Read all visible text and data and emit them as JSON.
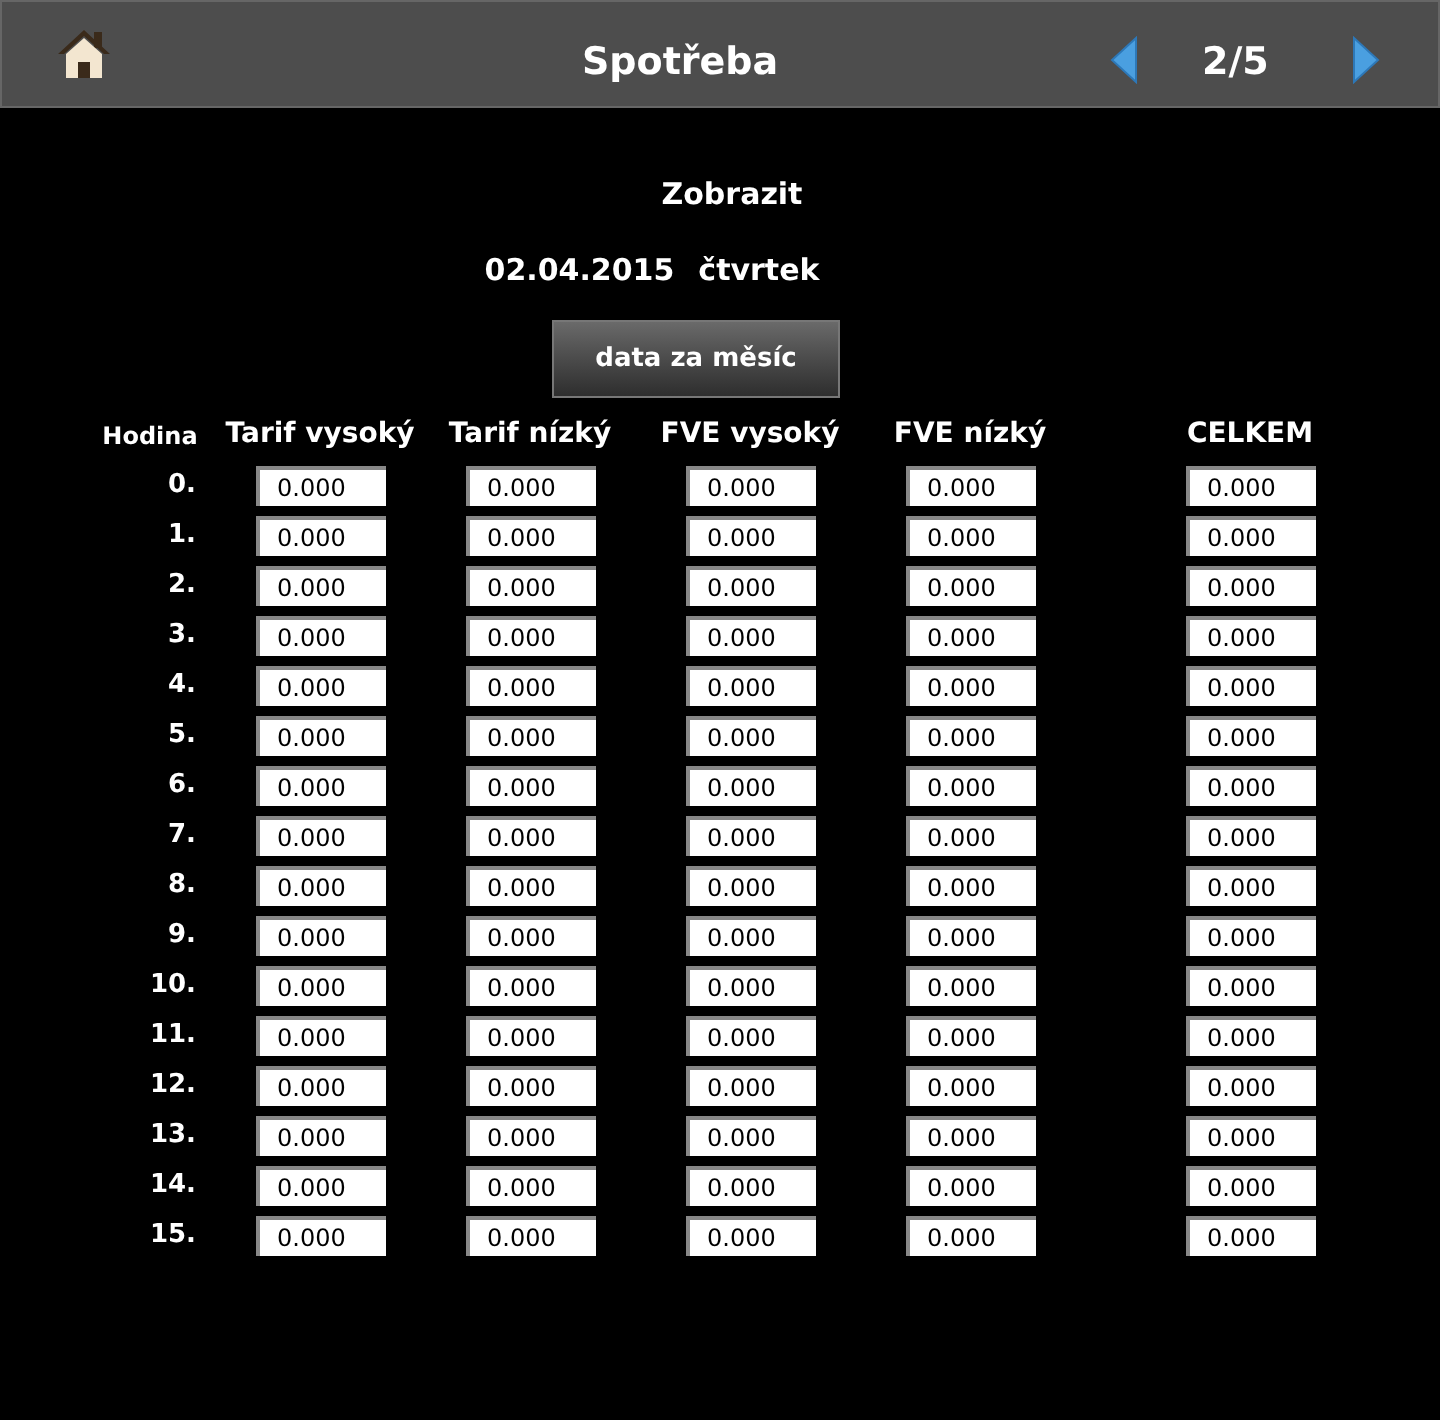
{
  "header": {
    "title": "Spotřeba",
    "page": "2/5"
  },
  "section_title": "Zobrazit",
  "date": "02.04.2015",
  "weekday": "čtvrtek",
  "month_button": "data za měsíc",
  "table": {
    "columns": [
      "Hodina",
      "Tarif vysoký",
      "Tarif nízký",
      "FVE vysoký",
      "FVE nízký",
      "CELKEM"
    ],
    "rows": [
      {
        "hour": "0.",
        "values": [
          "0.000",
          "0.000",
          "0.000",
          "0.000",
          "0.000"
        ]
      },
      {
        "hour": "1.",
        "values": [
          "0.000",
          "0.000",
          "0.000",
          "0.000",
          "0.000"
        ]
      },
      {
        "hour": "2.",
        "values": [
          "0.000",
          "0.000",
          "0.000",
          "0.000",
          "0.000"
        ]
      },
      {
        "hour": "3.",
        "values": [
          "0.000",
          "0.000",
          "0.000",
          "0.000",
          "0.000"
        ]
      },
      {
        "hour": "4.",
        "values": [
          "0.000",
          "0.000",
          "0.000",
          "0.000",
          "0.000"
        ]
      },
      {
        "hour": "5.",
        "values": [
          "0.000",
          "0.000",
          "0.000",
          "0.000",
          "0.000"
        ]
      },
      {
        "hour": "6.",
        "values": [
          "0.000",
          "0.000",
          "0.000",
          "0.000",
          "0.000"
        ]
      },
      {
        "hour": "7.",
        "values": [
          "0.000",
          "0.000",
          "0.000",
          "0.000",
          "0.000"
        ]
      },
      {
        "hour": "8.",
        "values": [
          "0.000",
          "0.000",
          "0.000",
          "0.000",
          "0.000"
        ]
      },
      {
        "hour": "9.",
        "values": [
          "0.000",
          "0.000",
          "0.000",
          "0.000",
          "0.000"
        ]
      },
      {
        "hour": "10.",
        "values": [
          "0.000",
          "0.000",
          "0.000",
          "0.000",
          "0.000"
        ]
      },
      {
        "hour": "11.",
        "values": [
          "0.000",
          "0.000",
          "0.000",
          "0.000",
          "0.000"
        ]
      },
      {
        "hour": "12.",
        "values": [
          "0.000",
          "0.000",
          "0.000",
          "0.000",
          "0.000"
        ]
      },
      {
        "hour": "13.",
        "values": [
          "0.000",
          "0.000",
          "0.000",
          "0.000",
          "0.000"
        ]
      },
      {
        "hour": "14.",
        "values": [
          "0.000",
          "0.000",
          "0.000",
          "0.000",
          "0.000"
        ]
      },
      {
        "hour": "15.",
        "values": [
          "0.000",
          "0.000",
          "0.000",
          "0.000",
          "0.000"
        ]
      }
    ]
  }
}
